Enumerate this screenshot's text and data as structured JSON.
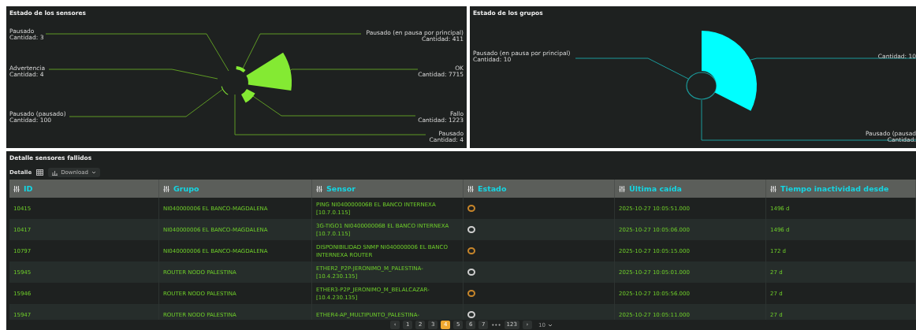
{
  "sensor_status": {
    "title": "Estado de los sensores",
    "left_labels": [
      {
        "label": "Pausado",
        "count": "Cantidad: 3"
      },
      {
        "label": "Advertencia",
        "count": "Cantidad: 4"
      },
      {
        "label": "Pausado  (pausado)",
        "count": "Cantidad: 100"
      }
    ],
    "right_labels": [
      {
        "label": "Pausado  (en pausa por principal)",
        "count": "Cantidad: 411"
      },
      {
        "label": "OK",
        "count": "Cantidad: 7715"
      },
      {
        "label": "Fallo",
        "count": "Cantidad: 1223"
      },
      {
        "label": "Pausado",
        "count": "Cantidad: 4"
      }
    ]
  },
  "group_status": {
    "title": "Estado de los grupos",
    "left_labels": [
      {
        "label": "Pausado  (en pausa por principal)",
        "count": "Cantidad: 10"
      }
    ],
    "right_labels": [
      {
        "count": "Cantidad: 10"
      },
      {
        "label": "Pausado  (pausad",
        "count": "Cantidad:"
      }
    ]
  },
  "failed_sensors": {
    "title": "Detalle sensores fallidos",
    "toolbar_label": "Detalle",
    "download_button": "Download",
    "columns": [
      "ID",
      "Grupo",
      "Sensor",
      "Estado",
      "Última caída",
      "Tiempo inactividad desde"
    ],
    "rows": [
      {
        "id": "10415",
        "group": "NI040000006 EL BANCO-MAGDALENA",
        "sensor": "PING NI040000006B EL BANCO INTERNEXA [10.7.0.115]",
        "status": {
          "color": "#c8862a"
        },
        "last_down": "2025-10-27 10:05:51.000",
        "downtime": "1496 d"
      },
      {
        "id": "10417",
        "group": "NI040000006 EL BANCO-MAGDALENA",
        "sensor": "3G-TIGO1 NI040000006B EL BANCO INTERNEXA [10.7.0.115]",
        "status": {
          "color": "#d0d0d0"
        },
        "last_down": "2025-10-27 10:05:06.000",
        "downtime": "1496 d"
      },
      {
        "id": "10797",
        "group": "NI040000006 EL BANCO-MAGDALENA",
        "sensor": "DISPONIBILIDAD SNMP NI040000006 EL BANCO INTERNEXA ROUTER",
        "status": {
          "color": "#c8862a"
        },
        "last_down": "2025-10-27 10:05:15.000",
        "downtime": "172 d"
      },
      {
        "id": "15945",
        "group": "ROUTER NODO PALESTINA",
        "sensor": "ETHER2_P2P-JERONIMO_M_PALESTINA-[10.4.230.135]",
        "status": {
          "color": "#d0d0d0"
        },
        "last_down": "2025-10-27 10:05:01.000",
        "downtime": "27 d"
      },
      {
        "id": "15946",
        "group": "ROUTER NODO PALESTINA",
        "sensor": "ETHER3-P2P_JERONIMO_M_BELALCAZAR-[10.4.230.135]",
        "status": {
          "color": "#c8862a"
        },
        "last_down": "2025-10-27 10:05:56.000",
        "downtime": "27 d"
      },
      {
        "id": "15947",
        "group": "ROUTER NODO PALESTINA",
        "sensor": "ETHER4-AP_MULTIPUNTO_PALESTINA-",
        "status": {
          "color": "#d0d0d0"
        },
        "last_down": "2025-10-27 10:05:11.000",
        "downtime": "27 d"
      }
    ],
    "pagination": {
      "prev": "‹",
      "pages": [
        {
          "label": "1",
          "selected": false
        },
        {
          "label": "2",
          "selected": false
        },
        {
          "label": "3",
          "selected": false
        },
        {
          "label": "4",
          "selected": true
        },
        {
          "label": "5",
          "selected": false
        },
        {
          "label": "6",
          "selected": false
        },
        {
          "label": "7",
          "selected": false
        }
      ],
      "ellipsis": "•••",
      "last": "123",
      "next": "›",
      "page_size": "10"
    }
  }
}
